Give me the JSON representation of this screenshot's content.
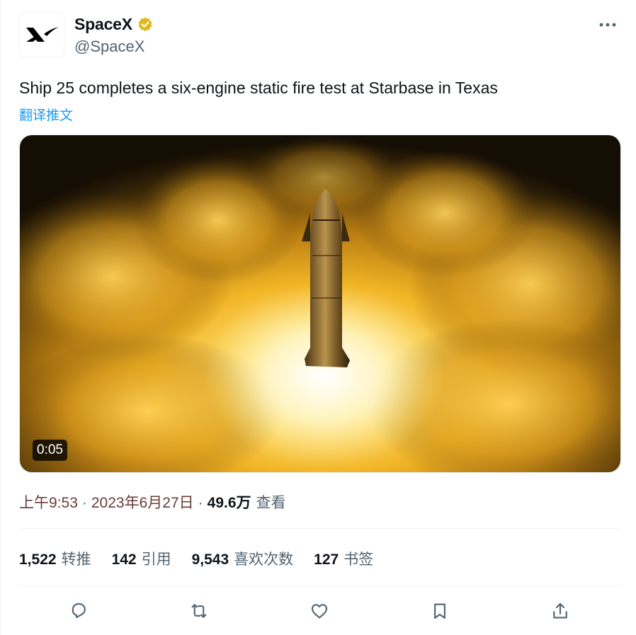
{
  "author": {
    "display_name": "SpaceX",
    "handle": "@SpaceX",
    "logo_text": "SpaceX logo",
    "verified": true
  },
  "tweet": {
    "text": "Ship 25 completes a six-engine static fire test at Starbase in Texas",
    "translate_label": "翻译推文"
  },
  "media": {
    "duration": "0:05",
    "icon": "video-thumbnail"
  },
  "meta": {
    "time": "上午9:53",
    "separator": "·",
    "date": "2023年6月27日",
    "views_count": "49.6万",
    "views_label": "查看"
  },
  "stats": [
    {
      "count": "1,522",
      "label": "转推"
    },
    {
      "count": "142",
      "label": "引用"
    },
    {
      "count": "9,543",
      "label": "喜欢次数"
    },
    {
      "count": "127",
      "label": "书签"
    }
  ],
  "actions": [
    {
      "icon": "reply-icon"
    },
    {
      "icon": "retweet-icon"
    },
    {
      "icon": "like-icon"
    },
    {
      "icon": "bookmark-icon"
    },
    {
      "icon": "share-icon"
    }
  ],
  "colors": {
    "link": "#1d9bf0",
    "secondary_text": "#536471",
    "primary_text": "#0f1419",
    "verified_badge": "#e2b719",
    "divider": "#eff3f4"
  }
}
